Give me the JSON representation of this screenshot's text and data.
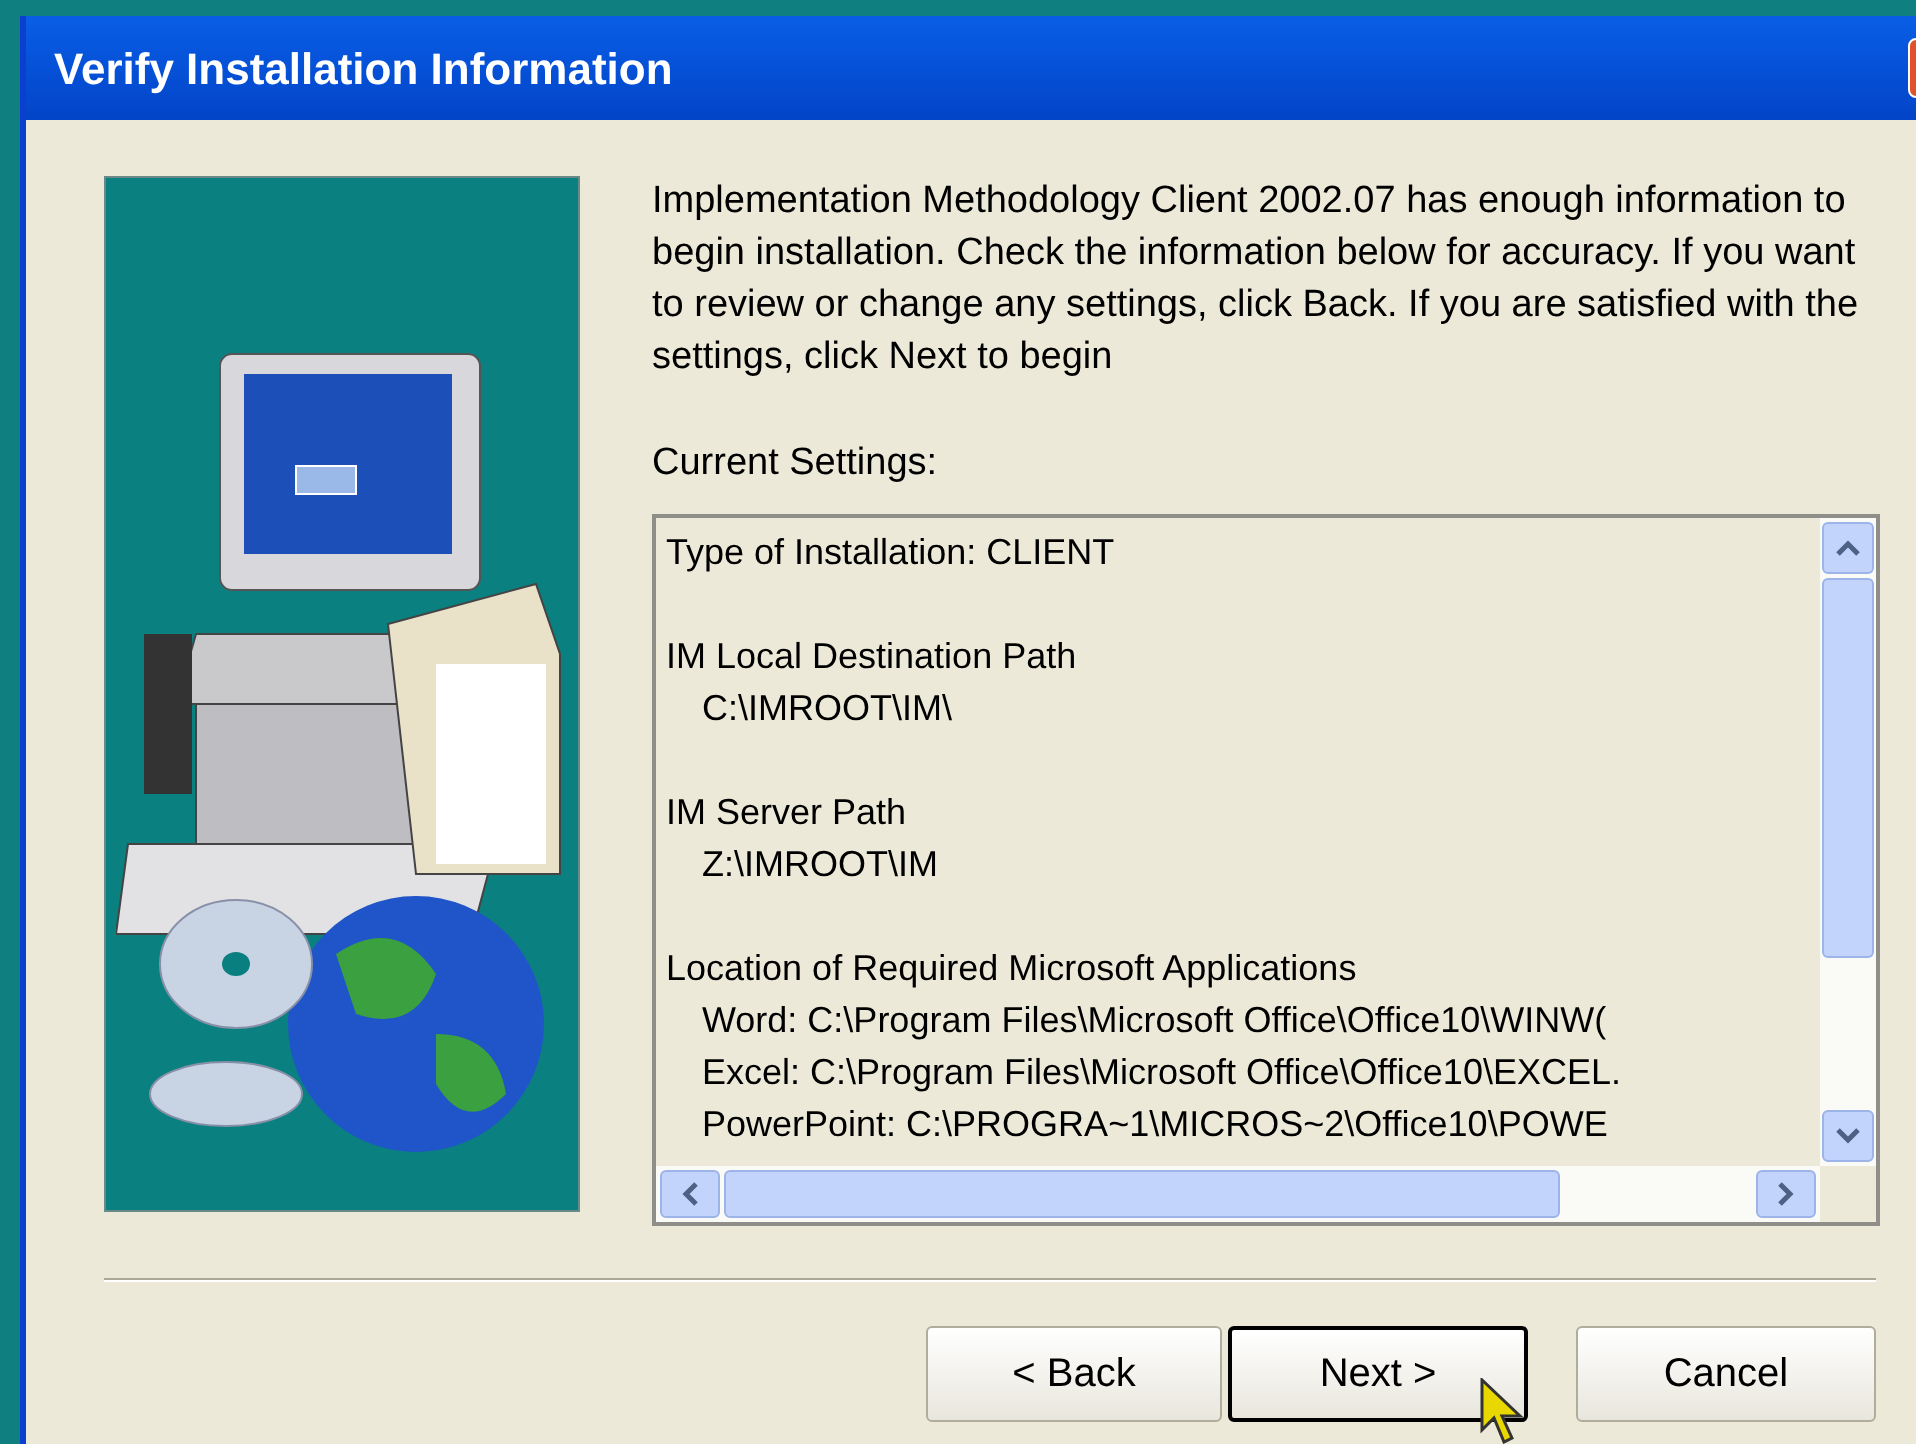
{
  "window": {
    "title": "Verify Installation Information"
  },
  "description": "Implementation Methodology Client 2002.07 has enough information to begin installation.  Check the information below for accuracy.  If you want to review or change any settings, click Back.  If you are satisfied with the settings, click Next to begin",
  "settings": {
    "label": "Current Settings:",
    "entries": [
      {
        "text": "Type of Installation: CLIENT"
      },
      {
        "text": "IM Local Destination Path",
        "children": [
          {
            "text": "C:\\IMROOT\\IM\\"
          }
        ]
      },
      {
        "text": "IM Server Path",
        "children": [
          {
            "text": "Z:\\IMROOT\\IM"
          }
        ]
      },
      {
        "text": "Location of Required Microsoft Applications",
        "children": [
          {
            "text": "Word: C:\\Program Files\\Microsoft Office\\Office10\\WINW("
          },
          {
            "text": "Excel: C:\\Program Files\\Microsoft Office\\Office10\\EXCEL."
          },
          {
            "text": "PowerPoint: C:\\PROGRA~1\\MICROS~2\\Office10\\POWE"
          }
        ]
      }
    ]
  },
  "buttons": [
    {
      "label": "< Back",
      "default": false
    },
    {
      "label": "Next >",
      "default": true
    },
    {
      "label": "Cancel",
      "default": false
    }
  ]
}
